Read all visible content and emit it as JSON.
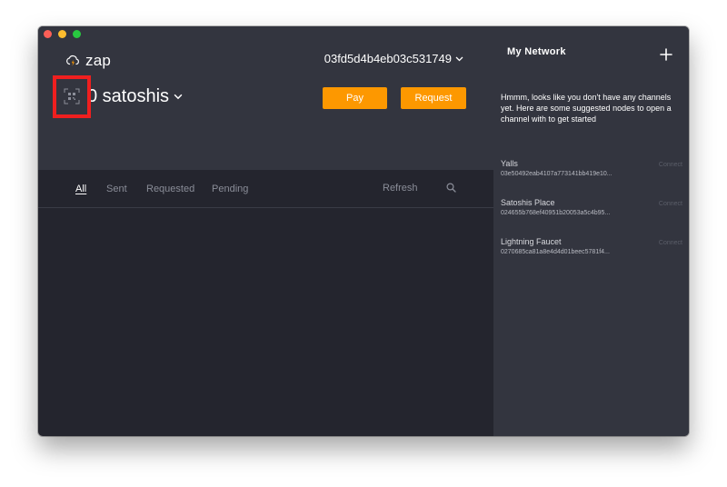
{
  "app": {
    "name": "zap",
    "pubkey": "03fd5d4b4eb03c531749"
  },
  "wallet": {
    "balance_label": "0 satoshis"
  },
  "actions": {
    "pay_label": "Pay",
    "request_label": "Request"
  },
  "tabs": [
    {
      "label": "All",
      "active": true
    },
    {
      "label": "Sent",
      "active": false
    },
    {
      "label": "Requested",
      "active": false
    },
    {
      "label": "Pending",
      "active": false
    }
  ],
  "toolbar": {
    "refresh_label": "Refresh"
  },
  "sidebar": {
    "title": "My Network",
    "empty_message": "Hmmm, looks like you don't have any channels yet. Here are some suggested nodes to open a channel with to get started",
    "nodes": [
      {
        "name": "Yalls",
        "pubkey": "03e50492eab4107a773141bb419e10...",
        "action": "Connect"
      },
      {
        "name": "Satoshis Place",
        "pubkey": "024655b768ef40951b20053a5c4b95...",
        "action": "Connect"
      },
      {
        "name": "Lightning Faucet",
        "pubkey": "0270685ca81a8e4d4d01beec5781f4...",
        "action": "Connect"
      }
    ]
  },
  "colors": {
    "accent": "#fd9800",
    "annotation": "#ef1f1f",
    "sidebar_bg": "#33353f",
    "main_bg": "#24252e"
  },
  "icons": {
    "brand": "lightning-cloud-icon",
    "qr": "qr-code-icon",
    "chevron": "chevron-down-icon",
    "search": "search-icon",
    "add": "plus-icon"
  }
}
